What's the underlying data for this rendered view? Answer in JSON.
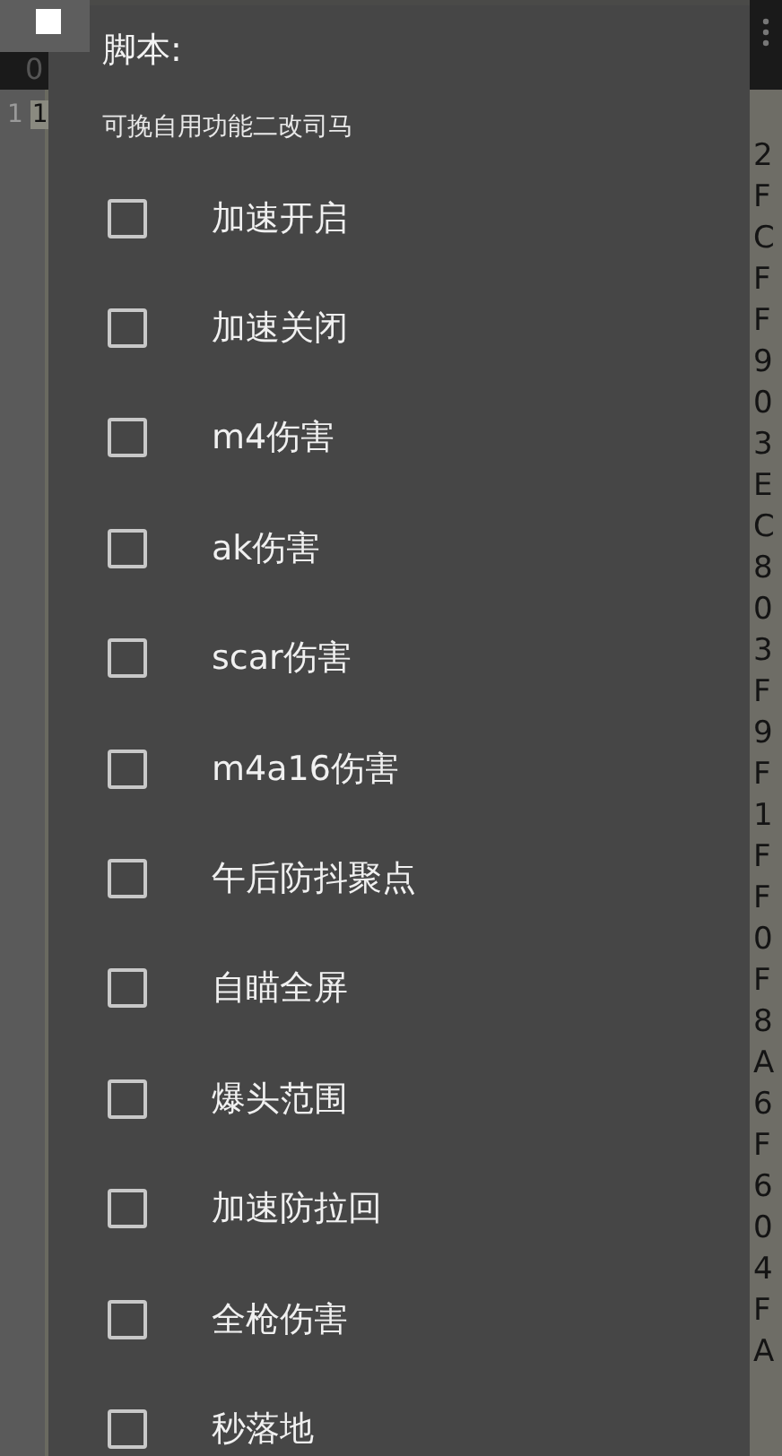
{
  "editor": {
    "header_fragment": "0",
    "line_number": "1",
    "line_fragment": "1",
    "right_fragments": [
      "2",
      "F",
      "C",
      "F",
      "F",
      "9",
      "0",
      "3",
      "E",
      "C",
      "8",
      "0",
      "3",
      "F",
      "9",
      "F",
      "1",
      "F",
      "F",
      "0",
      "F",
      "8",
      "A",
      "6",
      "F",
      "6",
      "0",
      "4",
      "F",
      "A"
    ]
  },
  "dialog": {
    "title": "脚本:",
    "subtitle": "可挽自用功能二改司马",
    "options": [
      {
        "label": "加速开启",
        "checked": false
      },
      {
        "label": "加速关闭",
        "checked": false
      },
      {
        "label": "m4伤害",
        "checked": false
      },
      {
        "label": "ak伤害",
        "checked": false
      },
      {
        "label": "scar伤害",
        "checked": false
      },
      {
        "label": "m4a16伤害",
        "checked": false
      },
      {
        "label": "午后防抖聚点",
        "checked": false
      },
      {
        "label": "自瞄全屏",
        "checked": false
      },
      {
        "label": "爆头范围",
        "checked": false
      },
      {
        "label": "加速防拉回",
        "checked": false
      },
      {
        "label": "全枪伤害",
        "checked": false
      },
      {
        "label": "秒落地",
        "checked": false
      }
    ]
  }
}
